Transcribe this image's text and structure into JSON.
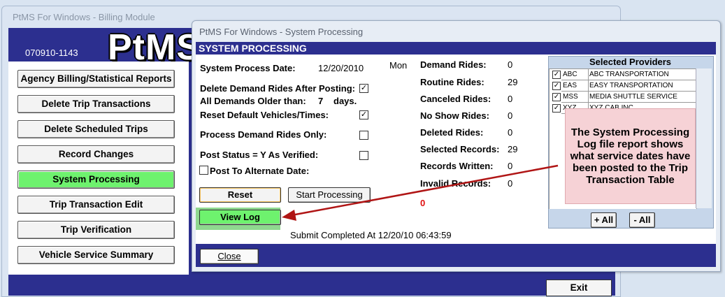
{
  "billing_window": {
    "title": "PtMS For Windows - Billing Module",
    "version": "070910-1143",
    "logo": "PtMS",
    "menu": [
      {
        "label": "Agency Billing/Statistical Reports"
      },
      {
        "label": "Delete Trip Transactions"
      },
      {
        "label": "Delete Scheduled Trips"
      },
      {
        "label": "Record Changes"
      },
      {
        "label": "System Processing"
      },
      {
        "label": "Trip Transaction Edit"
      },
      {
        "label": "Trip Verification"
      },
      {
        "label": "Vehicle Service Summary"
      }
    ],
    "exit_label": "Exit"
  },
  "sys_window": {
    "title": "PtMS For Windows - System Processing",
    "banner": "SYSTEM PROCESSING",
    "process_date_label": "System Process Date:",
    "process_date": "12/20/2010",
    "weekday": "Mon",
    "delete_demand_label": "Delete Demand Rides After Posting:",
    "older_than_label": "All Demands Older than:",
    "older_than_value": "7",
    "older_than_unit": "days.",
    "reset_defaults_label": "Reset Default Vehicles/Times:",
    "process_demand_only_label": "Process Demand Rides Only:",
    "post_status_label": "Post Status = Y As Verified:",
    "post_alternate_label": "Post To Alternate Date:",
    "check_mark": "✓",
    "reset_button": "Reset",
    "start_button": "Start Processing",
    "viewlog_button": "View Log",
    "status_text": "Submit Completed At 12/20/10 06:43:59",
    "close_button": "Close",
    "counter_red": "0",
    "stats": [
      {
        "label": "Demand Rides:",
        "value": "0"
      },
      {
        "label": "Routine Rides:",
        "value": "29"
      },
      {
        "label": "Canceled Rides:",
        "value": "0"
      },
      {
        "label": "No Show Rides:",
        "value": "0"
      },
      {
        "label": "Deleted Rides:",
        "value": "0"
      },
      {
        "label": "Selected Records:",
        "value": "29"
      },
      {
        "label": "Records Written:",
        "value": "0"
      },
      {
        "label": "Invalid Records:",
        "value": "0"
      }
    ]
  },
  "providers": {
    "title": "Selected Providers",
    "rows": [
      {
        "code": "ABC",
        "name": "ABC TRANSPORTATION"
      },
      {
        "code": "EAS",
        "name": "EASY TRANSPORTATION"
      },
      {
        "code": "MSS",
        "name": "MEDIA SHUTTLE SERVICE"
      },
      {
        "code": "XYZ",
        "name": "XYZ CAB INC"
      }
    ],
    "add_all": "+ All",
    "remove_all": "- All"
  },
  "callout": {
    "text": "The System Processing Log file report shows what service dates have been posted to the Trip Transaction Table"
  },
  "colors": {
    "accent": "#2c2f8f",
    "active_button": "#6ef26e",
    "callout_bg": "#f6d2d6",
    "arrow": "#b01515"
  }
}
